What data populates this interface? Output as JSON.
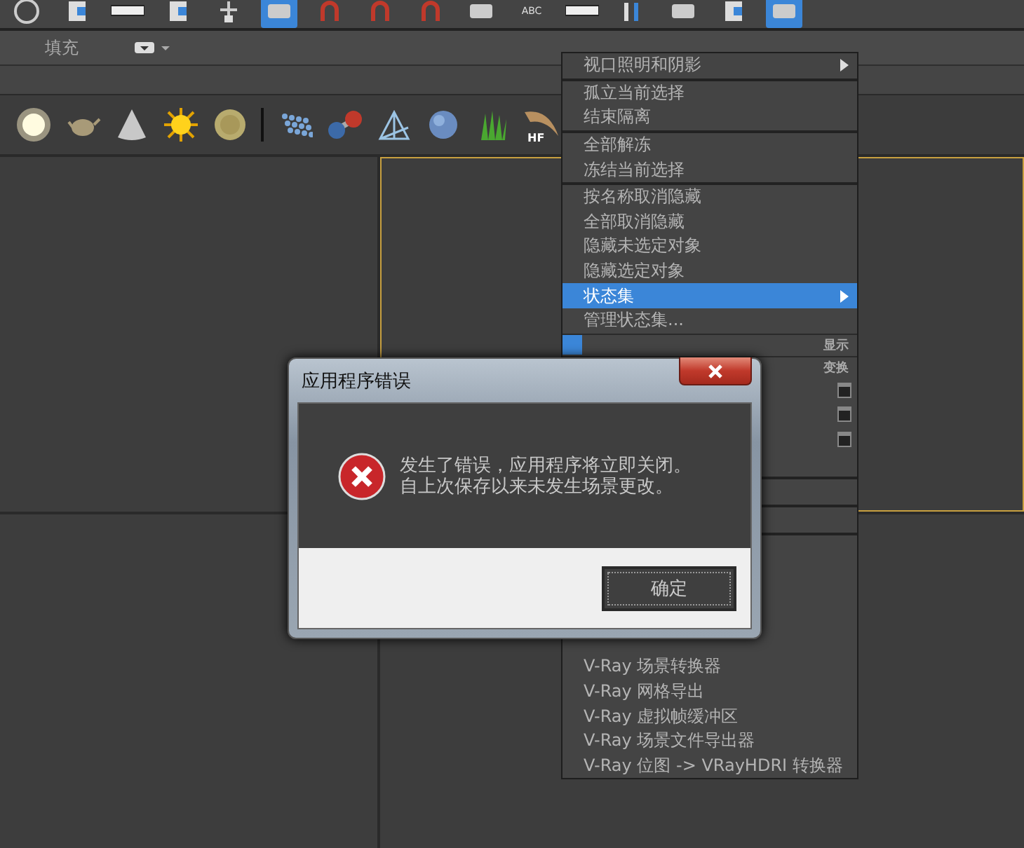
{
  "toolbar": [
    {
      "kind": "ring",
      "selected": false
    },
    {
      "kind": "doc",
      "selected": false
    },
    {
      "kind": "field",
      "selected": false
    },
    {
      "kind": "doc",
      "selected": false
    },
    {
      "kind": "node",
      "selected": false
    },
    {
      "kind": "tile",
      "selected": true
    },
    {
      "kind": "magnet",
      "selected": false
    },
    {
      "kind": "magnet",
      "selected": false
    },
    {
      "kind": "magnet",
      "selected": false
    },
    {
      "kind": "tile",
      "selected": false
    },
    {
      "kind": "abc",
      "label": "ABC",
      "selected": false
    },
    {
      "kind": "field",
      "selected": false
    },
    {
      "kind": "bars",
      "selected": false
    },
    {
      "kind": "tile",
      "selected": false
    },
    {
      "kind": "doc",
      "selected": false
    },
    {
      "kind": "tile",
      "selected": true
    }
  ],
  "ribbon": {
    "tab": "填充"
  },
  "shelf": [
    {
      "kind": "light"
    },
    {
      "kind": "teapot"
    },
    {
      "kind": "cone"
    },
    {
      "kind": "sun"
    },
    {
      "kind": "disc"
    },
    {
      "kind": "divider"
    },
    {
      "kind": "dots"
    },
    {
      "kind": "molecule"
    },
    {
      "kind": "pyramid"
    },
    {
      "kind": "blob"
    },
    {
      "kind": "grass"
    },
    {
      "kind": "hair",
      "label": "HF"
    }
  ],
  "viewports": [
    {
      "active": false
    },
    {
      "active": true
    },
    {
      "active": false
    },
    {
      "active": false
    }
  ],
  "context_menu": [
    {
      "kind": "item",
      "label": "视口照明和阴影",
      "submenu": true,
      "selected": false
    },
    {
      "kind": "separator"
    },
    {
      "kind": "item",
      "label": "孤立当前选择",
      "submenu": false,
      "selected": false
    },
    {
      "kind": "item",
      "label": "结束隔离",
      "submenu": false,
      "selected": false
    },
    {
      "kind": "separator"
    },
    {
      "kind": "item",
      "label": "全部解冻",
      "submenu": false,
      "selected": false
    },
    {
      "kind": "item",
      "label": "冻结当前选择",
      "submenu": false,
      "selected": false
    },
    {
      "kind": "separator"
    },
    {
      "kind": "item",
      "label": "按名称取消隐藏",
      "submenu": false,
      "selected": false
    },
    {
      "kind": "item",
      "label": "全部取消隐藏",
      "submenu": false,
      "selected": false
    },
    {
      "kind": "item",
      "label": "隐藏未选定对象",
      "submenu": false,
      "selected": false
    },
    {
      "kind": "item",
      "label": "隐藏选定对象",
      "submenu": false,
      "selected": false
    },
    {
      "kind": "item",
      "label": "状态集",
      "submenu": true,
      "selected": true
    },
    {
      "kind": "item",
      "label": "管理状态集...",
      "submenu": false,
      "selected": false
    },
    {
      "kind": "header",
      "label": "显示",
      "swatch": true
    },
    {
      "kind": "header",
      "label": "变换"
    },
    {
      "kind": "checkrow"
    },
    {
      "kind": "checkrow"
    },
    {
      "kind": "checkrow"
    },
    {
      "kind": "blank"
    },
    {
      "kind": "separator"
    },
    {
      "kind": "blank"
    },
    {
      "kind": "separator"
    },
    {
      "kind": "blank"
    },
    {
      "kind": "separator"
    },
    {
      "kind": "blank"
    },
    {
      "kind": "item",
      "label": "V-Ray 场景转换器",
      "submenu": false,
      "selected": false
    },
    {
      "kind": "item",
      "label": "V-Ray 网格导出",
      "submenu": false,
      "selected": false
    },
    {
      "kind": "item",
      "label": "V-Ray 虚拟帧缓冲区",
      "submenu": false,
      "selected": false
    },
    {
      "kind": "item",
      "label": "V-Ray 场景文件导出器",
      "submenu": false,
      "selected": false
    },
    {
      "kind": "item",
      "label": "V-Ray 位图 -> VRayHDRI 转换器",
      "submenu": false,
      "selected": false
    }
  ],
  "dialog": {
    "title": "应用程序错误",
    "message": [
      "发生了错误，应用程序将立即关闭。",
      "自上次保存以来未发生场景更改。"
    ],
    "button": "确定"
  }
}
